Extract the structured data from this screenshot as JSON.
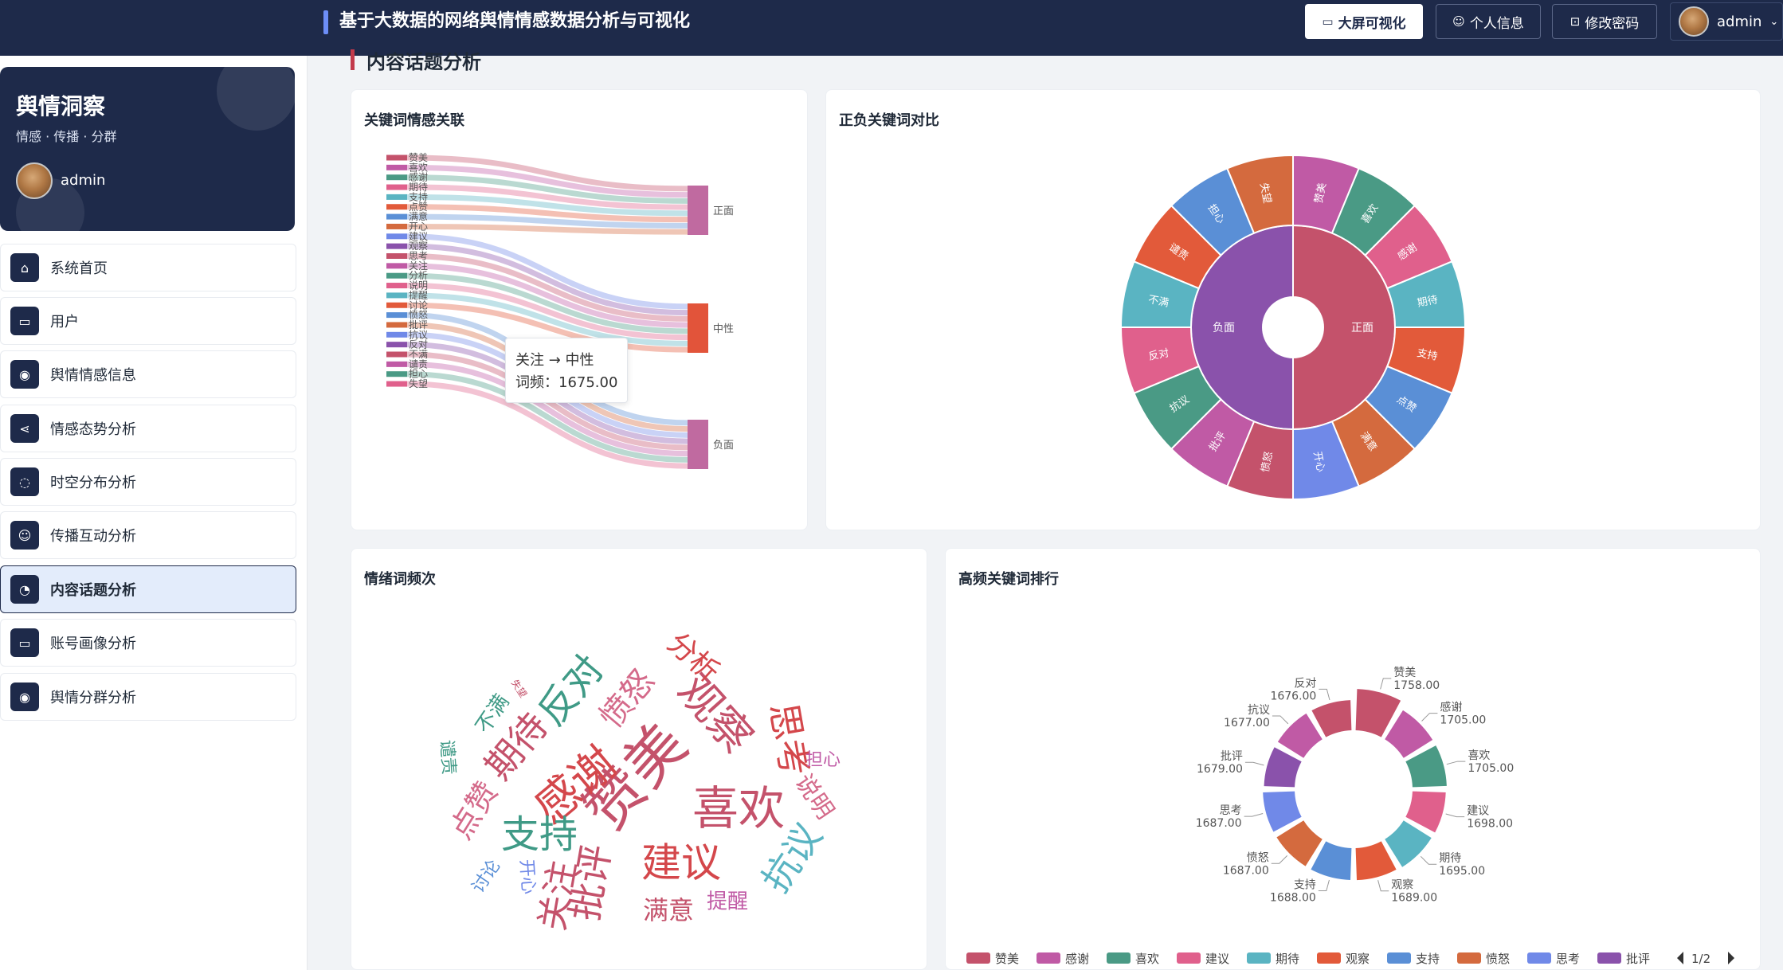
{
  "header": {
    "title": "基于大数据的网络舆情情感数据分析与可视化",
    "btn_bigscreen": "大屏可视化",
    "btn_profile": "个人信息",
    "btn_password": "修改密码",
    "username": "admin",
    "icons": {
      "bigscreen": "monitor-icon",
      "profile": "user-icon",
      "password": "lock-icon",
      "dropdown": "chevron-down-icon"
    }
  },
  "brand": {
    "name": "舆情洞察",
    "tagline": "情感 · 传播 · 分群",
    "user": "admin"
  },
  "nav": {
    "items": [
      {
        "label": "系统首页",
        "icon": "home-icon",
        "glyph": "⌂"
      },
      {
        "label": "用户",
        "icon": "monitor-icon",
        "glyph": "▭"
      },
      {
        "label": "舆情情感信息",
        "icon": "pin-icon",
        "glyph": "◉"
      },
      {
        "label": "情感态势分析",
        "icon": "share-icon",
        "glyph": "⋖"
      },
      {
        "label": "时空分布分析",
        "icon": "chat-icon",
        "glyph": "◌"
      },
      {
        "label": "传播互动分析",
        "icon": "user-icon",
        "glyph": "☺"
      },
      {
        "label": "内容话题分析",
        "icon": "pie-icon",
        "glyph": "◔"
      },
      {
        "label": "账号画像分析",
        "icon": "monitor-icon",
        "glyph": "▭"
      },
      {
        "label": "舆情分群分析",
        "icon": "pin-icon",
        "glyph": "◉"
      }
    ],
    "active": "内容话题分析"
  },
  "page": {
    "section_title": "内容话题分析"
  },
  "colors": {
    "navy": "#1e2a4a",
    "accent_red": "#c23a4b",
    "palette": [
      "#c4526b",
      "#c05aa5",
      "#4a9a85",
      "#e0608c",
      "#5ab4c2",
      "#e25a3a",
      "#5a8fd6",
      "#d46a3e",
      "#7089e8",
      "#8a52ab"
    ]
  },
  "charts": {
    "sankey_title": "关键词情感关联",
    "sunburst_title": "正负关键词对比",
    "wordcloud_title": "情绪词频次",
    "donut_title": "高频关键词排行",
    "tooltip_line1": "关注 → 中性",
    "tooltip_line2": "词频：1675.00",
    "legend_page": "1/2"
  },
  "chart_data": [
    {
      "type": "sankey",
      "title": "关键词情感关联",
      "targets": [
        "正面",
        "中性",
        "负面"
      ],
      "links": [
        {
          "source": "赞美",
          "target": "正面"
        },
        {
          "source": "喜欢",
          "target": "正面"
        },
        {
          "source": "感谢",
          "target": "正面"
        },
        {
          "source": "期待",
          "target": "正面"
        },
        {
          "source": "支持",
          "target": "正面"
        },
        {
          "source": "点赞",
          "target": "正面"
        },
        {
          "source": "满意",
          "target": "正面"
        },
        {
          "source": "开心",
          "target": "正面"
        },
        {
          "source": "建议",
          "target": "中性"
        },
        {
          "source": "观察",
          "target": "中性"
        },
        {
          "source": "思考",
          "target": "中性"
        },
        {
          "source": "关注",
          "target": "中性",
          "value": 1675
        },
        {
          "source": "分析",
          "target": "中性"
        },
        {
          "source": "说明",
          "target": "中性"
        },
        {
          "source": "提醒",
          "target": "中性"
        },
        {
          "source": "讨论",
          "target": "中性"
        },
        {
          "source": "愤怒",
          "target": "负面"
        },
        {
          "source": "批评",
          "target": "负面"
        },
        {
          "source": "抗议",
          "target": "负面"
        },
        {
          "source": "反对",
          "target": "负面"
        },
        {
          "source": "不满",
          "target": "负面"
        },
        {
          "source": "谴责",
          "target": "负面"
        },
        {
          "source": "担心",
          "target": "负面"
        },
        {
          "source": "失望",
          "target": "负面"
        }
      ]
    },
    {
      "type": "sunburst",
      "title": "正负关键词对比",
      "inner": [
        "正面",
        "负面"
      ],
      "outer": [
        {
          "name": "赞美",
          "parent": "正面"
        },
        {
          "name": "喜欢",
          "parent": "正面"
        },
        {
          "name": "感谢",
          "parent": "正面"
        },
        {
          "name": "期待",
          "parent": "正面"
        },
        {
          "name": "支持",
          "parent": "正面"
        },
        {
          "name": "点赞",
          "parent": "正面"
        },
        {
          "name": "满意",
          "parent": "正面"
        },
        {
          "name": "开心",
          "parent": "正面"
        },
        {
          "name": "愤怒",
          "parent": "负面"
        },
        {
          "name": "批评",
          "parent": "负面"
        },
        {
          "name": "抗议",
          "parent": "负面"
        },
        {
          "name": "反对",
          "parent": "负面"
        },
        {
          "name": "不满",
          "parent": "负面"
        },
        {
          "name": "谴责",
          "parent": "负面"
        },
        {
          "name": "担心",
          "parent": "负面"
        },
        {
          "name": "失望",
          "parent": "负面"
        }
      ]
    },
    {
      "type": "wordcloud",
      "title": "情绪词频次",
      "words": [
        "赞美",
        "感谢",
        "期待",
        "反对",
        "愤怒",
        "观察",
        "思考",
        "喜欢",
        "支持",
        "建议",
        "批评",
        "关注",
        "抗议",
        "点赞",
        "分析",
        "满意",
        "提醒",
        "说明",
        "担心",
        "不满",
        "谴责",
        "讨论",
        "开心",
        "失望"
      ]
    },
    {
      "type": "pie",
      "title": "高频关键词排行",
      "categories": [
        "赞美",
        "感谢",
        "喜欢",
        "建议",
        "期待",
        "观察",
        "支持",
        "愤怒",
        "思考",
        "批评",
        "抗议",
        "反对"
      ],
      "values": [
        1758,
        1705,
        1705,
        1698,
        1695,
        1689,
        1688,
        1687,
        1687,
        1679,
        1677,
        1676
      ],
      "value_labels": [
        "1758.00",
        "1705.00",
        "1705.00",
        "1698.00",
        "1695.00",
        "1689.00",
        "1688.00",
        "1687.00",
        "1687.00",
        "1679.00",
        "1677.00",
        "1676.00"
      ],
      "legend": [
        "赞美",
        "感谢",
        "喜欢",
        "建议",
        "期待",
        "观察",
        "支持",
        "愤怒",
        "思考",
        "批评"
      ],
      "legend_page": "1/2"
    }
  ]
}
